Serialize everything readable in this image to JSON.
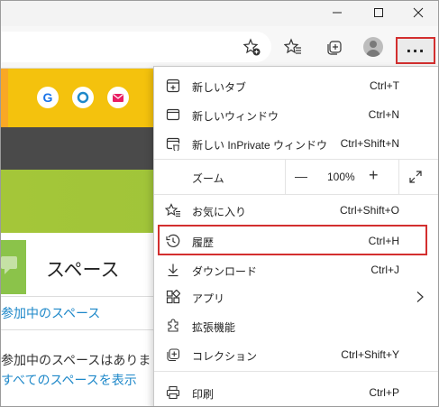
{
  "window": {
    "minimize_icon": "minimize-icon",
    "maximize_icon": "maximize-icon",
    "close_icon": "close-icon"
  },
  "toolbar": {
    "icons": [
      "add-favorite-icon",
      "favorites-icon",
      "collections-icon",
      "profile-icon"
    ],
    "more_label": "···"
  },
  "page": {
    "app_buttons": [
      {
        "label": "G",
        "color": "#1a73e8"
      },
      {
        "label": "",
        "color": "#1e88c9"
      },
      {
        "label": "",
        "color": "#e91e63"
      }
    ],
    "space_title": "スペース",
    "link_joined": "参加中のスペース",
    "text_joined": "参加中のスペースはありま",
    "link_all": "すべてのスペースを表示"
  },
  "menu": {
    "new_tab": {
      "label": "新しいタブ",
      "shortcut": "Ctrl+T"
    },
    "new_window": {
      "label": "新しいウィンドウ",
      "shortcut": "Ctrl+N"
    },
    "new_inprivate": {
      "label": "新しい InPrivate ウィンドウ",
      "shortcut": "Ctrl+Shift+N"
    },
    "zoom": {
      "label": "ズーム",
      "minus": "—",
      "value": "100%",
      "plus": "+"
    },
    "favorites": {
      "label": "お気に入り",
      "shortcut": "Ctrl+Shift+O"
    },
    "history": {
      "label": "履歴",
      "shortcut": "Ctrl+H"
    },
    "downloads": {
      "label": "ダウンロード",
      "shortcut": "Ctrl+J"
    },
    "apps": {
      "label": "アプリ"
    },
    "extensions": {
      "label": "拡張機能"
    },
    "collections": {
      "label": "コレクション",
      "shortcut": "Ctrl+Shift+Y"
    },
    "print": {
      "label": "印刷",
      "shortcut": "Ctrl+P"
    }
  },
  "colors": {
    "highlight": "#d32f2f",
    "yellow_bar": "#f4c20d",
    "dark_bar": "#4a4a4a",
    "green_bar": "#a4c639",
    "link": "#1e88c9"
  }
}
